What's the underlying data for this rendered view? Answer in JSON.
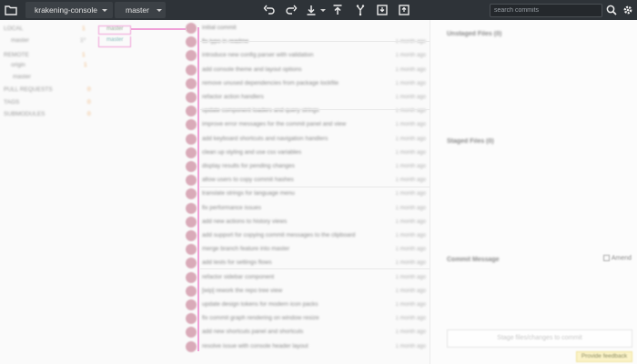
{
  "toolbar": {
    "repo_name": "krakening-console",
    "branch_name": "master",
    "search_placeholder": "search commits",
    "icons": [
      "folder-icon",
      "undo-icon",
      "redo-icon",
      "pull-icon",
      "push-icon",
      "branch-icon",
      "stash-icon",
      "pop-icon",
      "search-icon",
      "gear-icon"
    ]
  },
  "left_panel": {
    "rows": [
      {
        "label": "LOCAL",
        "count": "1"
      },
      {
        "label": "master",
        "count": "1*"
      },
      {
        "label": "REMOTE",
        "count": "1"
      },
      {
        "label": "origin",
        "count": "1"
      },
      {
        "label": "master",
        "count": ""
      },
      {
        "label": "PULL REQUESTS",
        "count": "0"
      },
      {
        "label": "TAGS",
        "count": "0"
      },
      {
        "label": "SUBMODULES",
        "count": "0"
      }
    ]
  },
  "graph": {
    "branch_labels": [
      "master",
      "master"
    ]
  },
  "commits": [
    {
      "msg": "initial commit",
      "time": ""
    },
    {
      "msg": "fix typo in readme",
      "time": "1 month ago"
    },
    {
      "msg": "introduce new config parser with validation",
      "time": "1 month ago"
    },
    {
      "msg": "add console theme and layout options",
      "time": "1 month ago"
    },
    {
      "msg": "remove unused dependencies from package lockfile",
      "time": "1 month ago"
    },
    {
      "msg": "refactor action handlers",
      "time": "1 month ago"
    },
    {
      "msg": "update component loaders and query strings",
      "time": "1 month ago"
    },
    {
      "msg": "improve error messages for the commit panel and view",
      "time": "1 month ago"
    },
    {
      "msg": "add keyboard shortcuts and navigation handlers",
      "time": "1 month ago"
    },
    {
      "msg": "clean up styling and use css variables",
      "time": "1 month ago"
    },
    {
      "msg": "display results for pending changes",
      "time": "1 month ago"
    },
    {
      "msg": "allow users to copy commit hashes",
      "time": "1 month ago"
    },
    {
      "msg": "translate strings for language menu",
      "time": "1 month ago"
    },
    {
      "msg": "fix performance issues",
      "time": "1 month ago"
    },
    {
      "msg": "add new actions to history views",
      "time": "1 month ago"
    },
    {
      "msg": "add support for copying commit messages to the clipboard",
      "time": "1 month ago"
    },
    {
      "msg": "merge branch feature into master",
      "time": "1 month ago"
    },
    {
      "msg": "add tests for settings flows",
      "time": "1 month ago"
    },
    {
      "msg": "refactor sidebar component",
      "time": "1 month ago"
    },
    {
      "msg": "[wip] rework the repo tree view",
      "time": "1 month ago"
    },
    {
      "msg": "update design tokens for modern icon packs",
      "time": "1 month ago"
    },
    {
      "msg": "fix commit graph rendering on window resize",
      "time": "1 month ago"
    },
    {
      "msg": "add new shortcuts panel and shortcuts",
      "time": "1 month ago"
    },
    {
      "msg": "resolve issue with console header layout",
      "time": "1 month ago"
    }
  ],
  "right_panel": {
    "unstaged_heading": "Unstaged Files (0)",
    "staged_heading": "Staged Files (0)",
    "commit_message_heading": "Commit Message",
    "amend_label": "Amend",
    "commit_button": "Stage files/changes to commit",
    "feedback_button": "Provide feedback"
  },
  "colors": {
    "toolbar_bg": "#2e3338",
    "graph_line": "#f0a0d8",
    "avatar": "#d9aab8",
    "count_orange": "#f0b070"
  }
}
